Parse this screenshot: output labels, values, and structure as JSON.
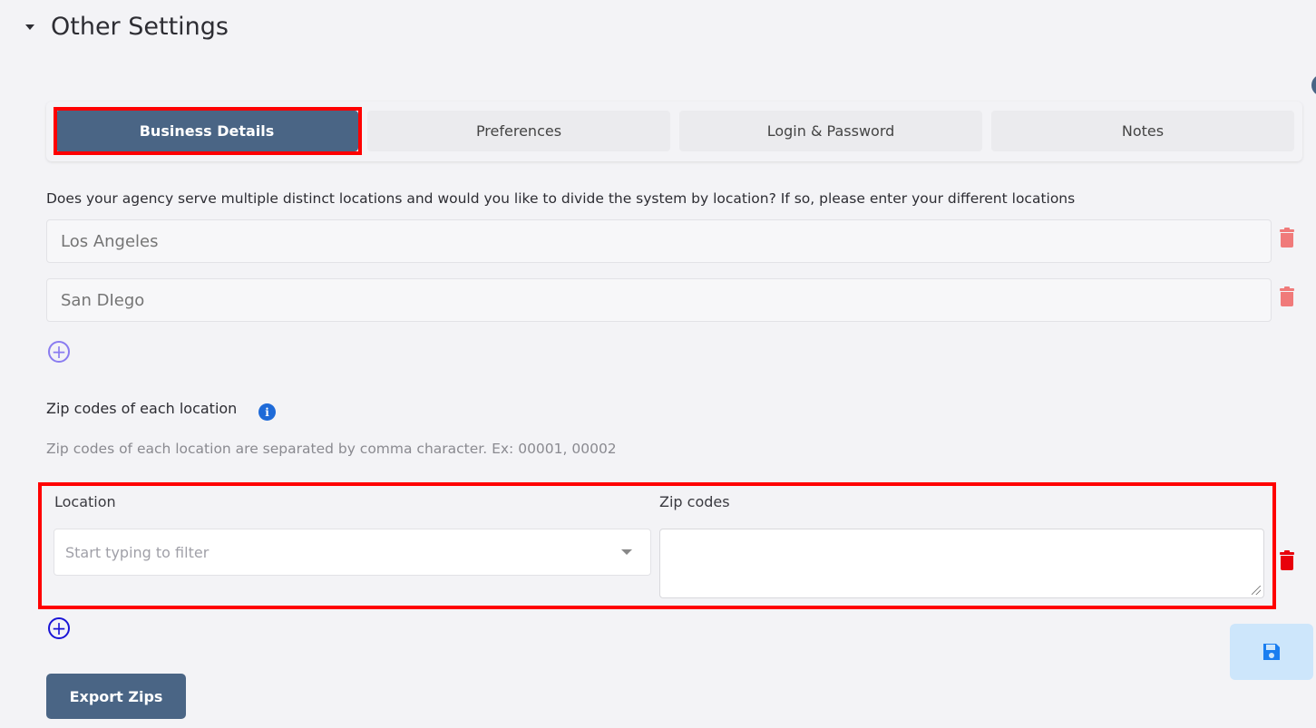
{
  "section": {
    "title": "Other Settings",
    "caret_icon": "caret-down-icon"
  },
  "tabs": [
    {
      "label": "Business Details",
      "active": true
    },
    {
      "label": "Preferences",
      "active": false
    },
    {
      "label": "Login & Password",
      "active": false
    },
    {
      "label": "Notes",
      "active": false
    }
  ],
  "locations": {
    "question": "Does your agency serve multiple distinct locations and would you like to divide the system by location? If so, please enter your different locations",
    "items": [
      {
        "placeholder": "Los Angeles"
      },
      {
        "placeholder": "San DIego"
      }
    ],
    "add_icon": "plus-circle-icon",
    "delete_icon": "trash-icon"
  },
  "zip_codes": {
    "title": "Zip codes of each location",
    "info_icon": "info-icon",
    "help": "Zip codes of each location are separated by comma character. Ex: 00001, 00002",
    "location_label": "Location",
    "zip_label": "Zip codes",
    "location_placeholder": "Start typing to filter",
    "zip_value": ""
  },
  "actions": {
    "export_label": "Export Zips",
    "save_icon": "floppy-disk-icon"
  },
  "colors": {
    "accent": "#4a6585",
    "highlight": "#ff0000",
    "delete_soft": "#f07a7a",
    "delete_hard": "#e8000b",
    "save_bg": "#cde6fb",
    "save_icon": "#1a7ef0"
  }
}
